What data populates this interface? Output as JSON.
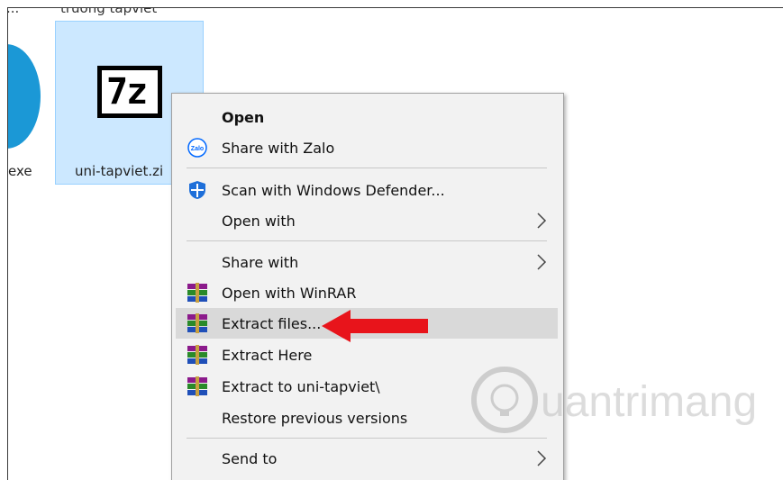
{
  "desktop": {
    "top_cut_left": "...",
    "top_cut_right": "truong tapviet",
    "left_item_label": "exe",
    "selected_file": {
      "name": "uni-tapviet.zi",
      "icon": "7z-archive-icon"
    }
  },
  "context_menu": {
    "items": [
      {
        "label": "Open",
        "icon": "",
        "bold": true
      },
      {
        "label": "Share with Zalo",
        "icon": "zalo-icon"
      },
      {
        "label": "Scan with Windows Defender...",
        "icon": "windows-defender-icon"
      },
      {
        "label": "Open with",
        "icon": "",
        "submenu": true
      },
      {
        "label": "Share with",
        "icon": "",
        "submenu": true
      },
      {
        "label": "Open with WinRAR",
        "icon": "winrar-icon"
      },
      {
        "label": "Extract files...",
        "icon": "winrar-icon",
        "highlighted": true
      },
      {
        "label": "Extract Here",
        "icon": "winrar-icon"
      },
      {
        "label": "Extract to uni-tapviet\\",
        "icon": "winrar-icon"
      },
      {
        "label": "Restore previous versions",
        "icon": ""
      },
      {
        "label": "Send to",
        "icon": "",
        "submenu": true
      }
    ]
  },
  "annotation": {
    "arrow_color": "#e8141b",
    "points_to": "Extract files..."
  },
  "watermark": {
    "text": "Quantrimang"
  },
  "colors": {
    "selection_bg": "#cce8ff",
    "menu_bg": "#f2f2f2",
    "highlight_bg": "#d9d9d9"
  }
}
